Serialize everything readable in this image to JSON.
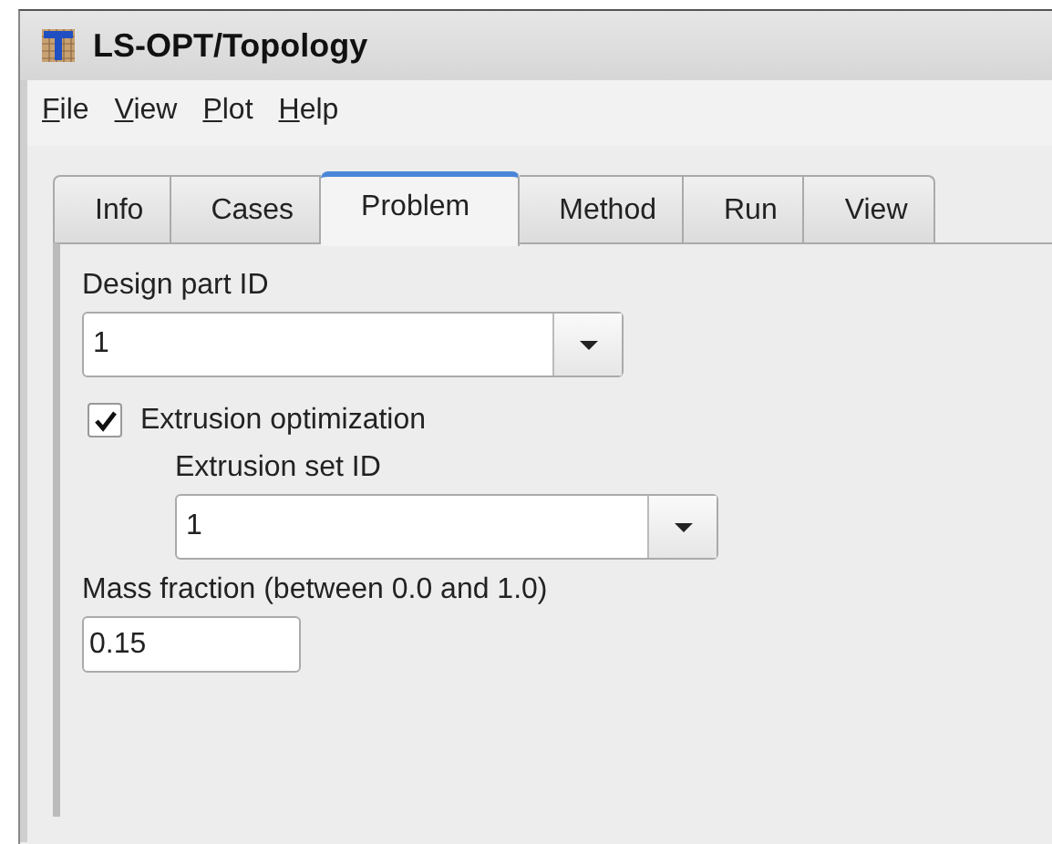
{
  "window": {
    "title": "LS-OPT/Topology"
  },
  "menu": [
    {
      "label": "File"
    },
    {
      "label": "View"
    },
    {
      "label": "Plot"
    },
    {
      "label": "Help"
    }
  ],
  "tabs": [
    {
      "label": "Info",
      "selected": false
    },
    {
      "label": "Cases",
      "selected": false
    },
    {
      "label": "Problem",
      "selected": true
    },
    {
      "label": "Method",
      "selected": false
    },
    {
      "label": "Run",
      "selected": false
    },
    {
      "label": "View",
      "selected": false
    }
  ],
  "design_part": {
    "label": "Design part ID",
    "value": "1"
  },
  "extrusion": {
    "label": "Extrusion optimization",
    "checked": true
  },
  "extrusion_set": {
    "label": "Extrusion set ID",
    "value": "1"
  },
  "mass_fraction": {
    "label": "Mass fraction (between 0.0 and 1.0)",
    "value": "0.15"
  }
}
